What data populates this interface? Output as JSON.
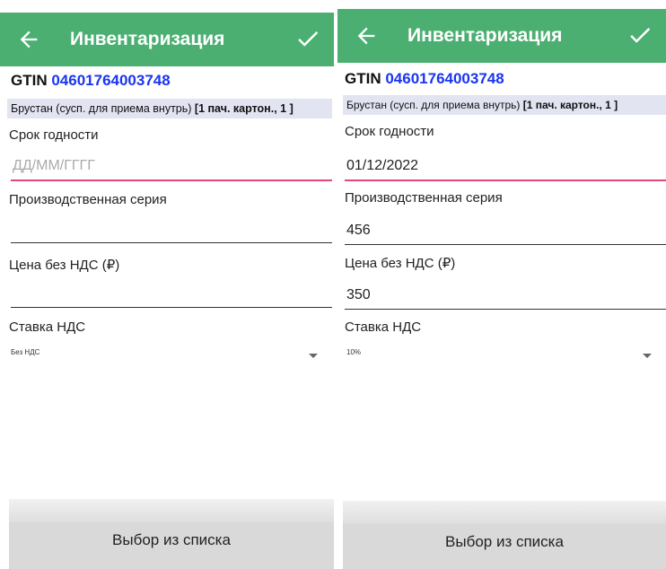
{
  "screens": [
    {
      "title": "Инвентаризация",
      "gtin_label": "GTIN",
      "gtin_code": "04601764003748",
      "product_name": "Брустан (сусп. для приема внутрь)",
      "product_pack": "[1 пач. картон., 1 ]",
      "expiry_label": "Срок годности",
      "expiry_value": "",
      "expiry_placeholder": "ДД/ММ/ГГГГ",
      "series_label": "Производственная серия",
      "series_value": "",
      "price_label": "Цена без НДС (₽)",
      "price_value": "",
      "vat_label": "Ставка НДС",
      "vat_value": "Без НДС",
      "button_label": "Выбор из списка"
    },
    {
      "title": "Инвентаризация",
      "gtin_label": "GTIN",
      "gtin_code": "04601764003748",
      "product_name": "Брустан (сусп. для приема внутрь)",
      "product_pack": "[1 пач. картон., 1 ]",
      "expiry_label": "Срок годности",
      "expiry_value": "01/12/2022",
      "expiry_placeholder": "",
      "series_label": "Производственная серия",
      "series_value": "456",
      "price_label": "Цена без НДС (₽)",
      "price_value": "350",
      "vat_label": "Ставка НДС",
      "vat_value": "10%",
      "button_label": "Выбор из списка"
    }
  ],
  "colors": {
    "appbar": "#4caf72",
    "gtin_code": "#1a35f0",
    "focus_underline": "#e0467a",
    "product_bg": "#e2e4f2"
  },
  "icons": {
    "back": "arrow-left-icon",
    "confirm": "checkmark-icon",
    "dropdown": "caret-down-icon"
  }
}
